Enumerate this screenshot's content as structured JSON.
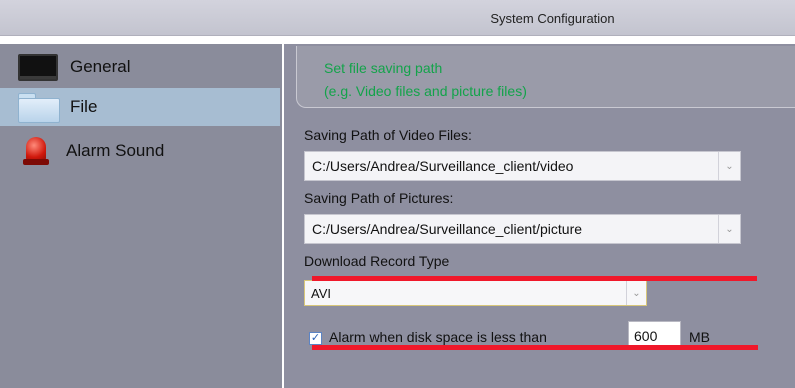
{
  "window": {
    "title": "System Configuration"
  },
  "sidebar": {
    "items": [
      {
        "label": "General",
        "icon": "monitor-icon",
        "selected": false
      },
      {
        "label": "File",
        "icon": "folder-icon",
        "selected": true
      },
      {
        "label": "Alarm Sound",
        "icon": "alarm-icon",
        "selected": false
      }
    ]
  },
  "main": {
    "banner": {
      "line1": "Set file saving path",
      "line2": "(e.g. Video files and picture files)"
    },
    "video_path": {
      "label": "Saving Path of Video Files:",
      "value": "C:/Users/Andrea/Surveillance_client/video"
    },
    "picture_path": {
      "label": "Saving Path of Pictures:",
      "value": "C:/Users/Andrea/Surveillance_client/picture"
    },
    "record_type": {
      "label": "Download Record Type",
      "value": "AVI"
    },
    "disk_alarm": {
      "checked": true,
      "check_mark": "✓",
      "label": "Alarm when disk space is less than",
      "value": "600",
      "unit": "MB"
    },
    "dropdown_glyph": "⌄"
  },
  "colors": {
    "hint_text": "#13a34a",
    "selected_item": "#a7bdd2",
    "annotation_line": "#f0182a"
  }
}
